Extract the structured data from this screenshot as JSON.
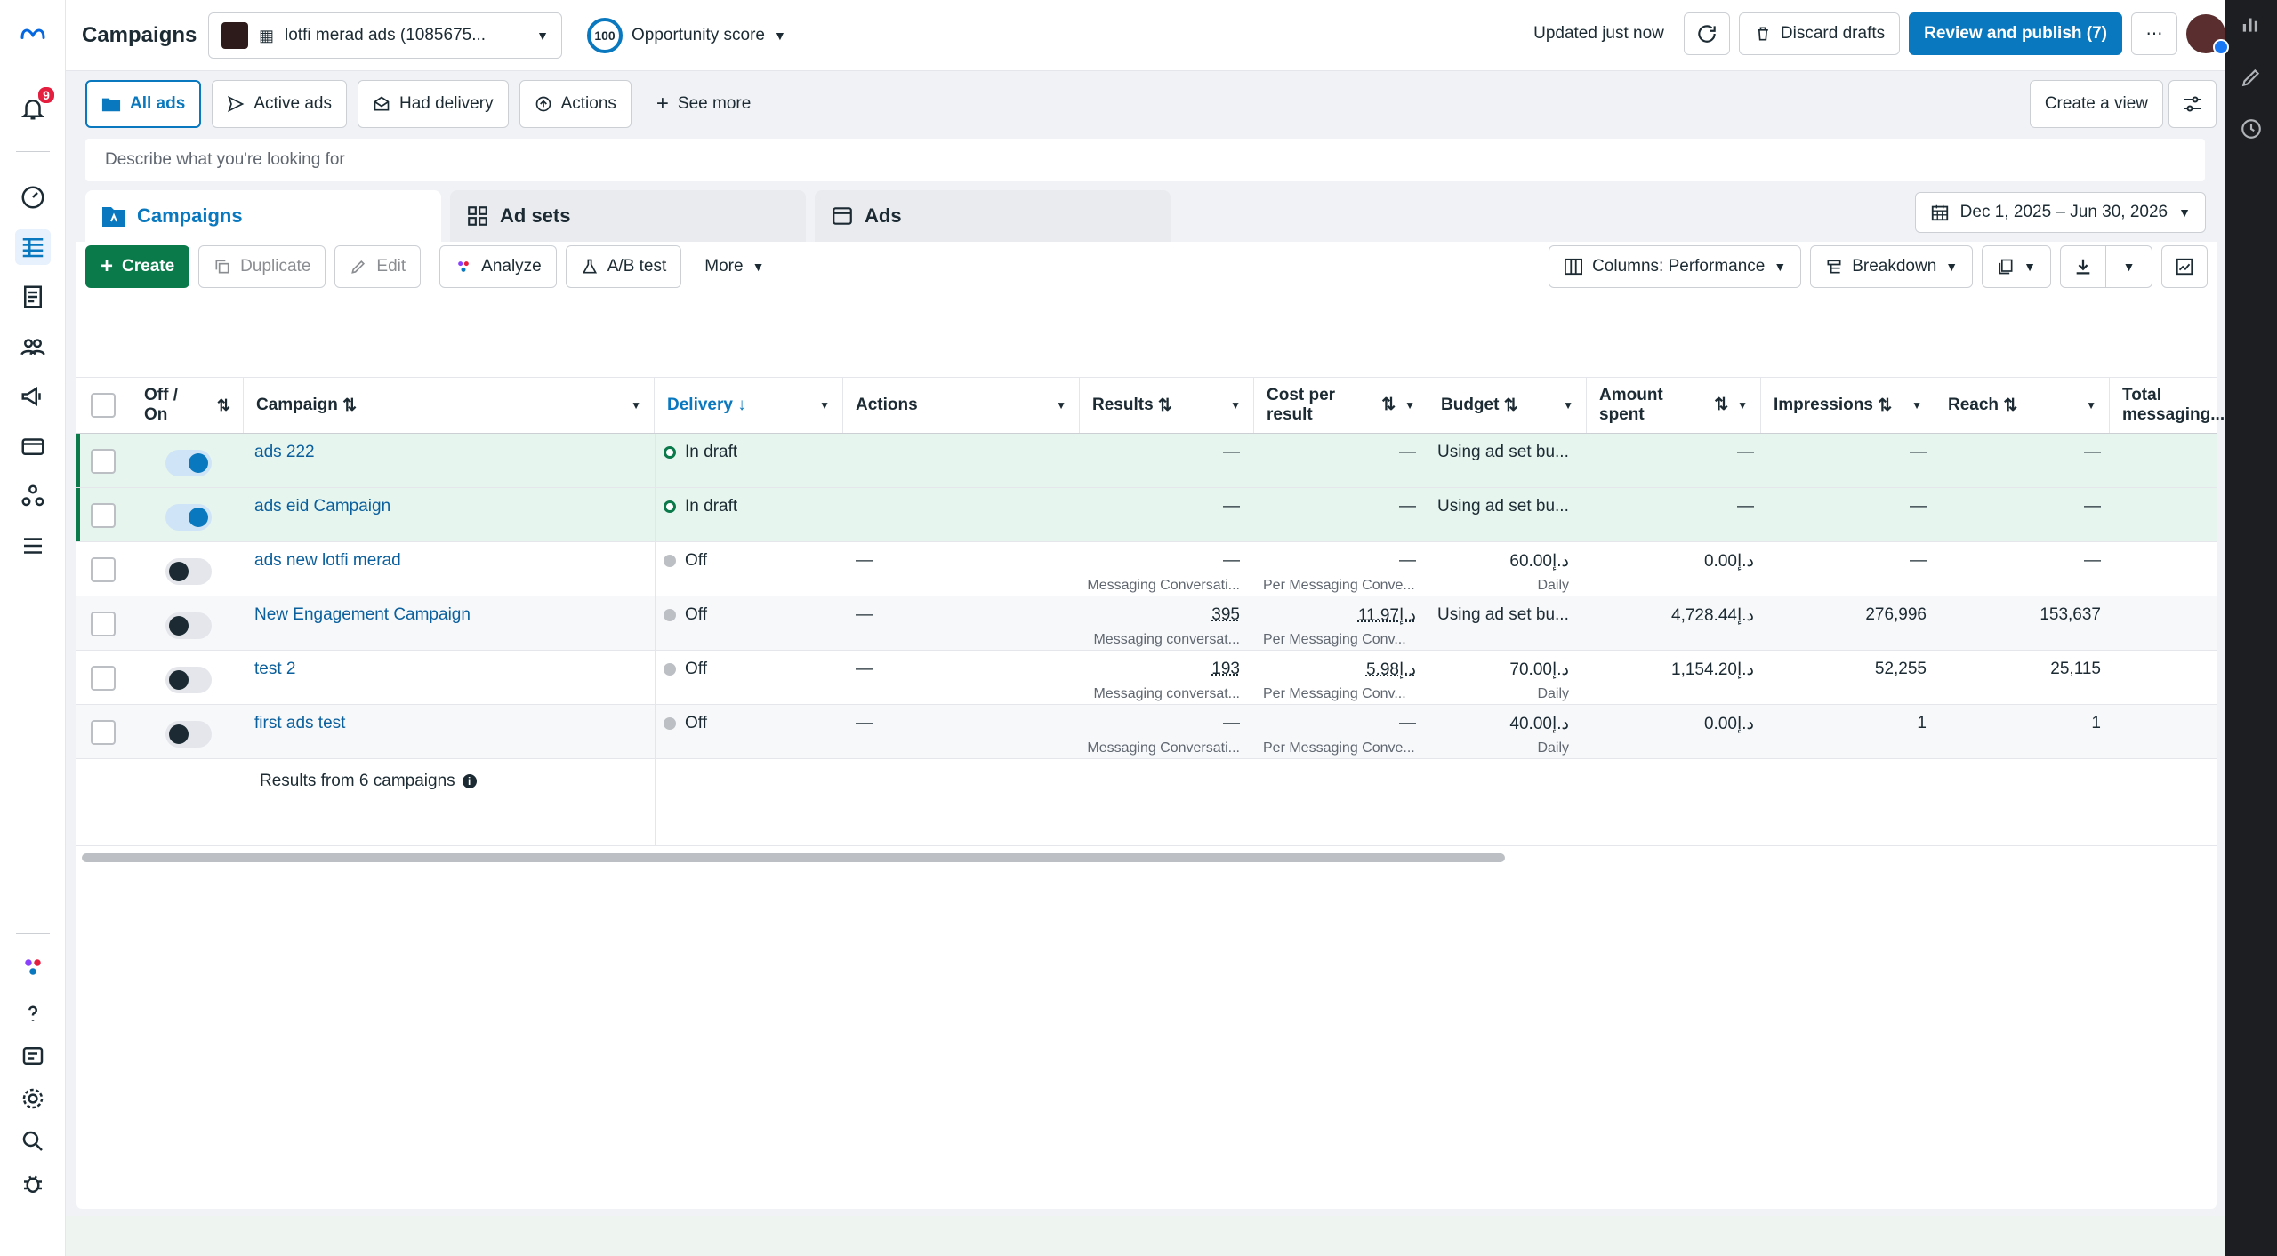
{
  "app": {
    "title": "Campaigns",
    "account": "lotfi merad ads (1085675...",
    "opportunity_score": "100",
    "opportunity_label": "Opportunity score",
    "updated": "Updated just now",
    "discard_label": "Discard drafts",
    "publish_label": "Review and publish (7)",
    "more_label": "⋯",
    "notifications_count": "9"
  },
  "filters": {
    "chips": [
      "All ads",
      "Active ads",
      "Had delivery",
      "Actions",
      "See more"
    ],
    "create_view": "Create a view"
  },
  "search": {
    "placeholder": "Describe what you're looking for"
  },
  "level_tabs": [
    "Campaigns",
    "Ad sets",
    "Ads"
  ],
  "date_range": "Dec 1, 2025 – Jun 30, 2026",
  "toolbar": {
    "create": "Create",
    "duplicate": "Duplicate",
    "edit": "Edit",
    "analyze": "Analyze",
    "ab_test": "A/B test",
    "more": "More",
    "columns": "Columns: Performance",
    "breakdown": "Breakdown"
  },
  "table": {
    "headers": {
      "off_on": "Off / On",
      "campaign": "Campaign",
      "delivery": "Delivery",
      "actions": "Actions",
      "results": "Results",
      "cost_per_result": "Cost per result",
      "budget": "Budget",
      "amount_spent": "Amount spent",
      "impressions": "Impressions",
      "reach": "Reach",
      "total_messaging": "Total messaging..."
    },
    "rows": [
      {
        "name": "ads 222",
        "delivery": "In draft",
        "actions": "",
        "results": "—",
        "results_sub": "",
        "cpr": "—",
        "cpr_sub": "",
        "budget": "Using ad set bu...",
        "budget_sub": "",
        "spent": "—",
        "impressions": "—",
        "reach": "—"
      },
      {
        "name": "ads eid Campaign",
        "delivery": "In draft",
        "actions": "",
        "results": "—",
        "results_sub": "",
        "cpr": "—",
        "cpr_sub": "",
        "budget": "Using ad set bu...",
        "budget_sub": "",
        "spent": "—",
        "impressions": "—",
        "reach": "—"
      },
      {
        "name": "ads new lotfi merad",
        "delivery": "Off",
        "actions": "—",
        "results": "—",
        "results_sub": "Messaging Conversati...",
        "cpr": "—",
        "cpr_sub": "Per Messaging Conve...",
        "budget": "60.00د.إ",
        "budget_sub": "Daily",
        "spent": "0.00د.إ",
        "impressions": "—",
        "reach": "—"
      },
      {
        "name": "New Engagement Campaign",
        "delivery": "Off",
        "actions": "—",
        "results": "395",
        "results_sub": "Messaging conversat...",
        "cpr": "11.97د.إ",
        "cpr_sub": "Per Messaging Conv...",
        "budget": "Using ad set bu...",
        "budget_sub": "",
        "spent": "4,728.44د.إ",
        "impressions": "276,996",
        "reach": "153,637"
      },
      {
        "name": "test 2",
        "delivery": "Off",
        "actions": "—",
        "results": "193",
        "results_sub": "Messaging conversat...",
        "cpr": "5.98د.إ",
        "cpr_sub": "Per Messaging Conv...",
        "budget": "70.00د.إ",
        "budget_sub": "Daily",
        "spent": "1,154.20د.إ",
        "impressions": "52,255",
        "reach": "25,115"
      },
      {
        "name": "first ads test",
        "delivery": "Off",
        "actions": "—",
        "results": "—",
        "results_sub": "Messaging Conversati...",
        "cpr": "—",
        "cpr_sub": "Per Messaging Conve...",
        "budget": "40.00د.إ",
        "budget_sub": "Daily",
        "spent": "0.00د.إ",
        "impressions": "1",
        "reach": "1"
      }
    ],
    "footer": "Results from 6 campaigns"
  },
  "colors": {
    "accent": "#0a78be",
    "create_green": "#0b7a4b",
    "draft_row": "#e7f5ef",
    "badge_red": "#e41e3f"
  }
}
